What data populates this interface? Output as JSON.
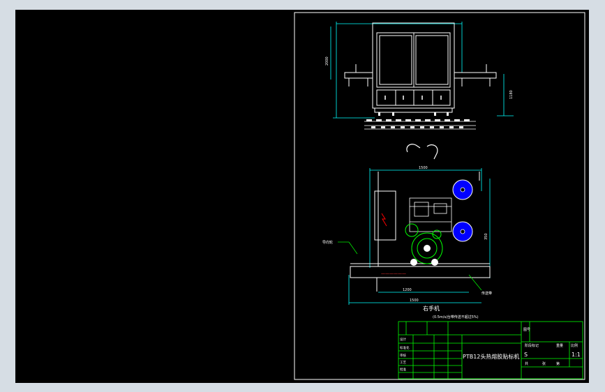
{
  "viewport": {
    "background": "#000000",
    "frame_color": "#d6dde4"
  },
  "colors": {
    "border": "#ffffff",
    "machine": "#ffffff",
    "dimension": "#00ffff",
    "annotation": "#00ff00",
    "roll": "#0000ff",
    "accent": "#ff0000"
  },
  "drawing": {
    "side_view_caption": "右手机",
    "side_view_note": "(0.5m/s/台带传送不超过5%)",
    "dims": {
      "width_top": "1500",
      "height_left": "2000",
      "height_right": "1180",
      "width_mid": "900",
      "width_bottom_inner": "1200",
      "width_bottom_outer": "1500",
      "vertical_right": "350"
    },
    "labels": {
      "left_callout": "导向轮",
      "right_callout": "传送带"
    }
  },
  "title_block": {
    "title": "PTB12头热熔胶贴标机",
    "scale": "1:1",
    "sheet_label": "S",
    "ratio_label": "比例",
    "stage_label": "阶段标记",
    "weight_label": "重量",
    "sheets_label": "共",
    "sheet_label2": "张",
    "page_label": "第",
    "left_rows": [
      "设计",
      "标准化",
      "审核",
      "工艺",
      "批准"
    ],
    "top_right": "图号"
  }
}
